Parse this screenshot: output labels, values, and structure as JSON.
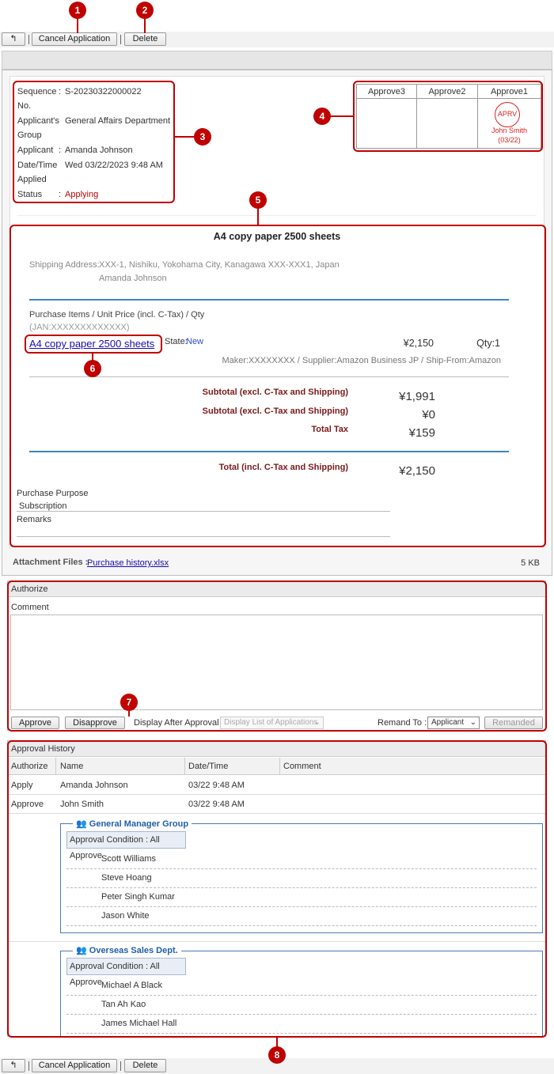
{
  "markers": [
    "1",
    "2",
    "3",
    "4",
    "5",
    "6",
    "7",
    "8"
  ],
  "toolbar": {
    "cancel_label": "Cancel Application",
    "delete_label": "Delete"
  },
  "info": {
    "seq_label": "Sequence",
    "seq_label2": "No.",
    "seq_value": "S-20230322000022",
    "grp_label": "Applicant's",
    "grp_label2": "Group",
    "grp_value": "General Affairs Department",
    "app_label": "Applicant",
    "app_value": "Amanda Johnson",
    "dt_label": "Date/Time",
    "dt_label2": "Applied",
    "dt_value": "Wed 03/22/2023 9:48 AM",
    "st_label": "Status",
    "st_value": "Applying"
  },
  "approvals": {
    "headers": [
      "Approve3",
      "Approve2",
      "Approve1"
    ],
    "stamp": "APRV",
    "stamp_name": "John Smith",
    "stamp_date": "(03/22)"
  },
  "form": {
    "title": "A4 copy paper 2500 sheets",
    "ship_label": "Shipping Address:",
    "ship_line1": "XXX-1, Nishiku, Yokohama City, Kanagawa XXX-XXX1, Japan",
    "ship_line2": "Amanda Johnson",
    "items_header": "Purchase Items / Unit Price (incl. C-Tax) / Qty",
    "jan": "(JAN:XXXXXXXXXXXXX)",
    "item_link": "A4 copy paper 2500 sheets",
    "state_label": "State:",
    "state_value": "New",
    "item_price": "¥2,150",
    "item_qty": "Qty:1",
    "maker": "Maker:XXXXXXXX / Supplier:Amazon Business JP / Ship-From:Amazon",
    "subtotal1_label": "Subtotal (excl. C-Tax and Shipping)",
    "subtotal1_value": "¥1,991",
    "subtotal2_label": "Subtotal (excl. C-Tax and Shipping)",
    "subtotal2_value": "¥0",
    "tax_label": "Total Tax",
    "tax_value": "¥159",
    "total_label": "Total (incl. C-Tax and Shipping)",
    "total_value": "¥2,150",
    "purpose_label": "Purchase Purpose",
    "purpose_value": "Subscription",
    "remarks_label": "Remarks"
  },
  "attach": {
    "label": "Attachment Files :",
    "file": "Purchase history.xlsx",
    "size": "5 KB"
  },
  "authorize": {
    "title": "Authorize",
    "comment_label": "Comment",
    "approve": "Approve",
    "disapprove": "Disapprove",
    "display_label": "Display After Approval :",
    "display_value": "Display List of Applications",
    "remand_label": "Remand To :",
    "remand_value": "Applicant",
    "remanded": "Remanded"
  },
  "history": {
    "title": "Approval History",
    "cols": [
      "Authorize",
      "Name",
      "Date/Time",
      "Comment"
    ],
    "rows": [
      {
        "auth": "Apply",
        "name": "Amanda Johnson",
        "dt": "03/22 9:48 AM"
      },
      {
        "auth": "Approve",
        "name": "John Smith",
        "dt": "03/22 9:48 AM"
      }
    ],
    "groups": [
      {
        "title": "General Manager Group",
        "cond": "Approval Condition : All Approve",
        "members": [
          "Scott Williams",
          "Steve Hoang",
          "Peter Singh Kumar",
          "Jason White"
        ]
      },
      {
        "title": "Overseas Sales Dept.",
        "cond": "Approval Condition : All Approve",
        "members": [
          "Michael A Black",
          "Tan Ah Kao",
          "James Michael Hall"
        ]
      }
    ]
  },
  "colors": {
    "marker": "#c00000",
    "link": "#1a0dab",
    "status": "#c00000",
    "total_label": "#7a1a1a",
    "group_title": "#1f5faa"
  }
}
